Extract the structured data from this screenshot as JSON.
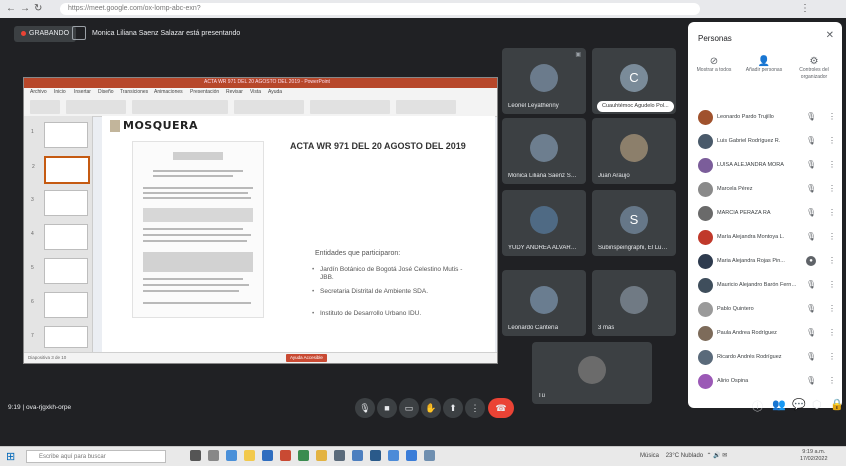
{
  "browser": {
    "url": "https://meet.google.com/ox-lomp-abc-exn?",
    "nav_icons": [
      "back-icon",
      "forward-icon",
      "reload-icon"
    ]
  },
  "meet": {
    "recording_label": "GRABANDO",
    "presenter_text": "Monica Liliana Saenz Salazar está presentando",
    "meeting_code": "ova-rjgxkh-orpe",
    "time": "9:19",
    "pin_label": "Cuauhtémoc Agudelo Pol..."
  },
  "slide": {
    "app_title": "ACTA WR 971 DEL 20 AGOSTO DEL 2019 - PowerPoint",
    "tabs": [
      "Archivo",
      "Inicio",
      "Insertar",
      "Diseño",
      "Transiciones",
      "Animaciones",
      "Presentación",
      "Revisar",
      "Vista",
      "Ayuda"
    ],
    "logo_text": "MOSQUERA",
    "title": "ACTA WR 971 DEL 20 AGOSTO DEL 2019",
    "subtitle": "Entidades que participaron:",
    "bullets": [
      "Jardín Botánico de Bogotá José Celestino Mutis - JBB.",
      "Secretaria Distrital de Ambiente SDA.",
      "Instituto de Desarrollo Urbano IDU."
    ],
    "status_text": "Diapositiva 3 de 10",
    "status_button": "Ayuda Accesible",
    "thumbnail_numbers": [
      "1",
      "2",
      "3",
      "4",
      "5",
      "6",
      "7"
    ]
  },
  "tiles": [
    {
      "name": "Leonel Leyathenny",
      "initial": "",
      "color": "#5f6b7a"
    },
    {
      "name": "",
      "initial": "C",
      "color": "#7a8b99"
    },
    {
      "name": "Monica Liliana Saenz Sal...",
      "initial": "",
      "color": "#6d7e8f"
    },
    {
      "name": "Juan Araujo",
      "initial": "",
      "color": "#8c7f6b"
    },
    {
      "name": "YUDY ANDREA ALVAREZ ...",
      "initial": "",
      "color": "#4f6a84"
    },
    {
      "name": "Subinspeingraphi, El Luna...",
      "initial": "S",
      "color": "#667788"
    },
    {
      "name": "Leonardo Cantería",
      "initial": "",
      "color": "#6a7d90"
    },
    {
      "name": "3 más",
      "initial": "",
      "color": "#707a84"
    },
    {
      "name": "Tú",
      "initial": "",
      "color": "#6b6b6b"
    }
  ],
  "panel": {
    "title": "Personas",
    "actions": [
      {
        "icon": "pin-off-icon",
        "label": "Mostrar a todos"
      },
      {
        "icon": "person-add-icon",
        "label": "Añadir personas"
      },
      {
        "icon": "settings-icon",
        "label": "Controles del organizador"
      }
    ],
    "participants": [
      {
        "name": "Leonardo Pardo Trujillo",
        "color": "#a0522d"
      },
      {
        "name": "Luis Gabriel Rodríguez R.",
        "color": "#4a5a6a"
      },
      {
        "name": "LUISA ALEJANDRA MORA",
        "color": "#7b5d9a"
      },
      {
        "name": "Marcela Pérez",
        "color": "#8a8a8a"
      },
      {
        "name": "MARCIA PERAZA RA",
        "color": "#6a6a6a"
      },
      {
        "name": "María Alejandra Montoya L.",
        "color": "#c0392b"
      },
      {
        "name": "Maria Alejandra Rojas Pin...",
        "color": "#2e3b4e"
      },
      {
        "name": "Mauricio Alejandro Barón Fernández",
        "color": "#3f4e5c"
      },
      {
        "name": "Pablo Quintero",
        "color": "#9a9a9a"
      },
      {
        "name": "Paula Andrea Rodríguez",
        "color": "#7d6b5a"
      },
      {
        "name": "Ricardo Andrés Rodríguez",
        "color": "#5a6a7a"
      },
      {
        "name": "Alirio Ospina",
        "color": "#9b59b6"
      }
    ]
  },
  "taskbar": {
    "search_placeholder": "Escribe aquí para buscar",
    "tray_text": "Música",
    "weather": "23°C Nublado",
    "time": "9:19 a.m.",
    "date": "17/02/2022"
  }
}
